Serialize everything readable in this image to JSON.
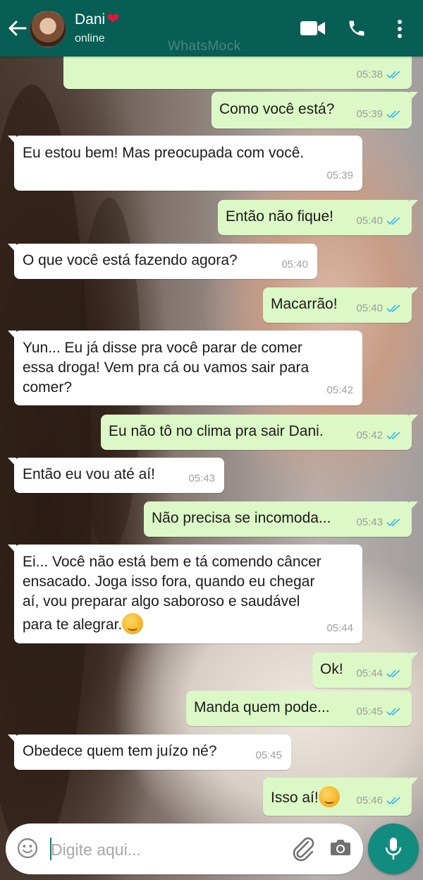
{
  "header": {
    "contact_name": "Dani",
    "heart": "❤",
    "status": "online",
    "watermark": "WhatsMock",
    "icons": [
      "back-arrow-icon",
      "video-call-icon",
      "phone-icon",
      "more-vert-icon"
    ]
  },
  "messages": [
    {
      "dir": "out",
      "text": "",
      "time": "05:38",
      "read": true
    },
    {
      "dir": "out",
      "text": "Como você está?",
      "time": "05:39",
      "read": true
    },
    {
      "dir": "in",
      "text": "Eu estou bem! Mas preocupada com você.",
      "time": "05:39"
    },
    {
      "dir": "out",
      "text": "Então não fique!",
      "time": "05:40",
      "read": true
    },
    {
      "dir": "in",
      "text": "O que você está fazendo agora?",
      "time": "05:40"
    },
    {
      "dir": "out",
      "text": "Macarrão!",
      "time": "05:40",
      "read": true
    },
    {
      "dir": "in",
      "lines": [
        "Yun... Eu já disse pra você parar de comer",
        "essa droga! Vem pra cá ou vamos sair para",
        "comer?"
      ],
      "time": "05:42"
    },
    {
      "dir": "out",
      "text": "Eu não tô no clima pra sair Dani.",
      "time": "05:42",
      "read": true
    },
    {
      "dir": "in",
      "text": "Então eu vou até aí!",
      "time": "05:43"
    },
    {
      "dir": "out",
      "text": "Não precisa se incomoda...",
      "time": "05:43",
      "read": true
    },
    {
      "dir": "in",
      "lines": [
        "Ei... Você não está bem e tá comendo câncer",
        "ensacado. Joga isso fora, quando eu chegar",
        "aí, vou preparar algo saboroso e saudável",
        "para te alegrar."
      ],
      "emoji": "relieved-face-emoji",
      "time": "05:44"
    },
    {
      "dir": "out",
      "text": "Ok!",
      "time": "05:44",
      "read": true
    },
    {
      "dir": "out",
      "text": "Manda quem pode...",
      "time": "05:45",
      "read": true
    },
    {
      "dir": "in",
      "text": "Obedece quem tem juízo né?",
      "time": "05:45"
    },
    {
      "dir": "out",
      "text": "Isso aí!",
      "emoji": "winking-face-emoji",
      "time": "05:46",
      "read": true
    }
  ],
  "composer": {
    "placeholder": "Digite aqui...",
    "icons": [
      "emoji-icon",
      "attach-icon",
      "camera-icon",
      "mic-icon"
    ]
  },
  "colors": {
    "header": "#075e54",
    "outgoing_bubble": "#dcf8c6",
    "incoming_bubble": "#ffffff",
    "read_tick": "#34b7f1",
    "mic_button": "#128c7e"
  }
}
